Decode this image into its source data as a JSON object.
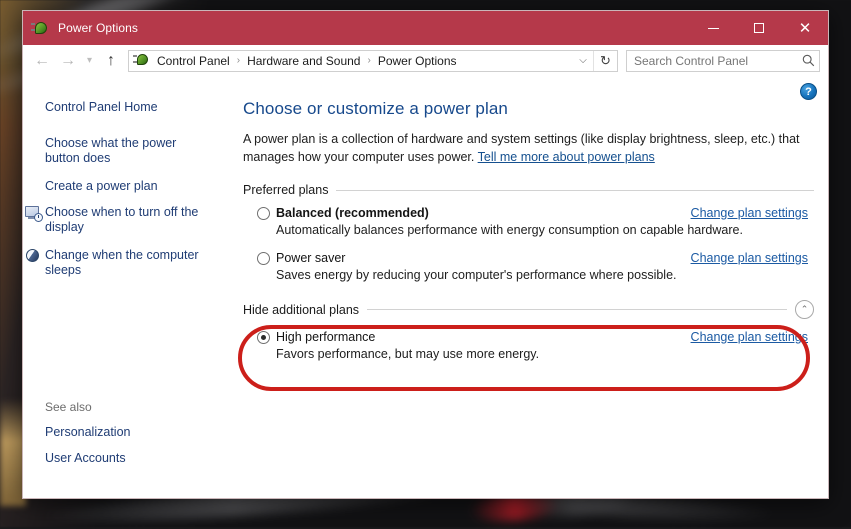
{
  "window": {
    "title": "Power Options",
    "title_icon": "power-plug-icon",
    "minimize_label": "Minimize",
    "maximize_label": "Maximize",
    "close_label": "Close"
  },
  "toolbar": {
    "back_label": "Back",
    "forward_label": "Forward",
    "recent_label": "Recent locations",
    "up_label": "Up",
    "breadcrumbs": [
      "Control Panel",
      "Hardware and Sound",
      "Power Options"
    ],
    "separator": "›",
    "dropdown_glyph": "⌵",
    "refresh_glyph": "↻",
    "refresh_label": "Refresh"
  },
  "search": {
    "placeholder": "Search Control Panel",
    "value": "",
    "icon": "search-icon"
  },
  "sidebar": {
    "items": [
      {
        "label": "Control Panel Home",
        "icon": null
      },
      {
        "label": "Choose what the power button does",
        "icon": null
      },
      {
        "label": "Create a power plan",
        "icon": null
      },
      {
        "label": "Choose when to turn off the display",
        "icon": "display-clock-icon"
      },
      {
        "label": "Change when the computer sleeps",
        "icon": "moon-sleep-icon"
      }
    ],
    "see_also": {
      "title": "See also",
      "items": [
        "Personalization",
        "User Accounts"
      ]
    }
  },
  "main": {
    "help_label": "?",
    "help_icon": "help-icon",
    "page_title": "Choose or customize a power plan",
    "intro_text": "A power plan is a collection of hardware and system settings (like display brightness, sleep, etc.) that manages how your computer uses power. ",
    "intro_link": "Tell me more about power plans",
    "preferred_section": {
      "heading": "Preferred plans",
      "plans": [
        {
          "name": "Balanced (recommended)",
          "description": "Automatically balances performance with energy consumption on capable hardware.",
          "selected": false,
          "bold": true,
          "change_link": "Change plan settings"
        },
        {
          "name": "Power saver",
          "description": "Saves energy by reducing your computer's performance where possible.",
          "selected": false,
          "bold": false,
          "change_link": "Change plan settings"
        }
      ]
    },
    "additional_section": {
      "heading": "Hide additional plans",
      "collapse_glyph": "⌃",
      "collapse_label": "Hide additional plans",
      "plans": [
        {
          "name": "High performance",
          "description": "Favors performance, but may use more energy.",
          "selected": true,
          "bold": false,
          "change_link": "Change plan settings"
        }
      ]
    }
  },
  "annotation": {
    "color": "#cc1f1a",
    "target": "high-performance-plan"
  },
  "colors": {
    "titlebar": "#b5394a",
    "link": "#1f3c74",
    "heading": "#17498c",
    "annotation": "#cc1f1a"
  }
}
